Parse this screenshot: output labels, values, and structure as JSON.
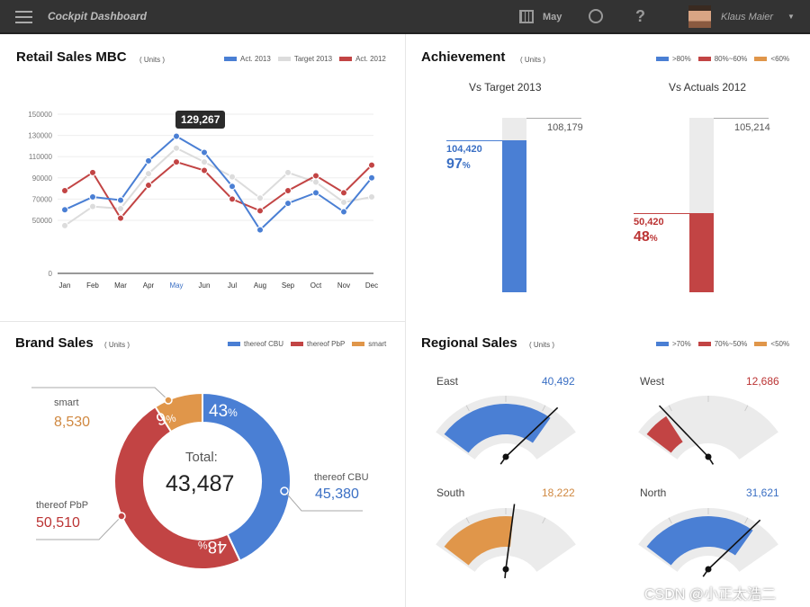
{
  "header": {
    "title": "Cockpit Dashboard",
    "month": "May",
    "user": "Klaus Maier"
  },
  "colors": {
    "blue": "#4a7fd4",
    "red": "#c24444",
    "orange": "#e0964a",
    "gray": "#dcdcdc"
  },
  "retail": {
    "title": "Retail Sales MBC",
    "units": "( Units )",
    "legend": [
      "Act. 2013",
      "Target 2013",
      "Act. 2012"
    ],
    "tooltip": "129,267"
  },
  "chart_data": {
    "type": "line",
    "categories": [
      "Jan",
      "Feb",
      "Mar",
      "Apr",
      "May",
      "Jun",
      "Jul",
      "Aug",
      "Sep",
      "Oct",
      "Nov",
      "Dec"
    ],
    "yticks": [
      "150000",
      "130000",
      "110000",
      "90000",
      "70000",
      "50000",
      "0"
    ],
    "ylim": [
      0,
      150000
    ],
    "highlight": "May",
    "series": [
      {
        "name": "Act. 2013",
        "color": "#4a7fd4",
        "values": [
          60000,
          72000,
          69000,
          106000,
          129267,
          114000,
          82000,
          41000,
          66000,
          76000,
          58000,
          90000
        ]
      },
      {
        "name": "Target 2013",
        "color": "#dcdcdc",
        "values": [
          45000,
          63000,
          61000,
          94000,
          118000,
          105000,
          91000,
          71000,
          95000,
          86000,
          67000,
          72000
        ]
      },
      {
        "name": "Act. 2012",
        "color": "#c24444",
        "values": [
          78000,
          95000,
          52000,
          83000,
          105000,
          97000,
          70000,
          59000,
          78000,
          92000,
          76000,
          102000
        ]
      }
    ]
  },
  "achievement": {
    "title": "Achievement",
    "units": "( Units )",
    "legend": [
      ">80%",
      "80%~60%",
      "<60%"
    ],
    "target": {
      "title": "Vs Target 2013",
      "total": "108,179",
      "value": "104,420",
      "pct": "97",
      "unit": "%"
    },
    "actual": {
      "title": "Vs Actuals 2012",
      "total": "105,214",
      "value": "50,420",
      "pct": "48",
      "unit": "%"
    }
  },
  "brand": {
    "title": "Brand Sales",
    "units": "( Units )",
    "legend": [
      "thereof CBU",
      "thereof PbP",
      "smart"
    ],
    "total_label": "Total:",
    "total": "43,487",
    "slices": [
      {
        "name": "thereof CBU",
        "value": "45,380",
        "pct": "43",
        "color": "#4a7fd4"
      },
      {
        "name": "thereof PbP",
        "value": "50,510",
        "pct": "48",
        "color": "#c24444"
      },
      {
        "name": "smart",
        "value": "8,530",
        "pct": "9",
        "color": "#e0964a"
      }
    ]
  },
  "regional": {
    "title": "Regional Sales",
    "units": "( Units )",
    "legend": [
      ">70%",
      "70%~50%",
      "<50%"
    ],
    "regions": [
      {
        "name": "East",
        "value": "40,492",
        "color": "#4a7fd4",
        "level": 0.82
      },
      {
        "name": "West",
        "value": "12,686",
        "color": "#c24444",
        "level": 0.2
      },
      {
        "name": "South",
        "value": "18,222",
        "color": "#e0964a",
        "level": 0.55
      },
      {
        "name": "North",
        "value": "31,621",
        "color": "#4a7fd4",
        "level": 0.82
      }
    ]
  },
  "watermark": "CSDN @小正太浩二"
}
